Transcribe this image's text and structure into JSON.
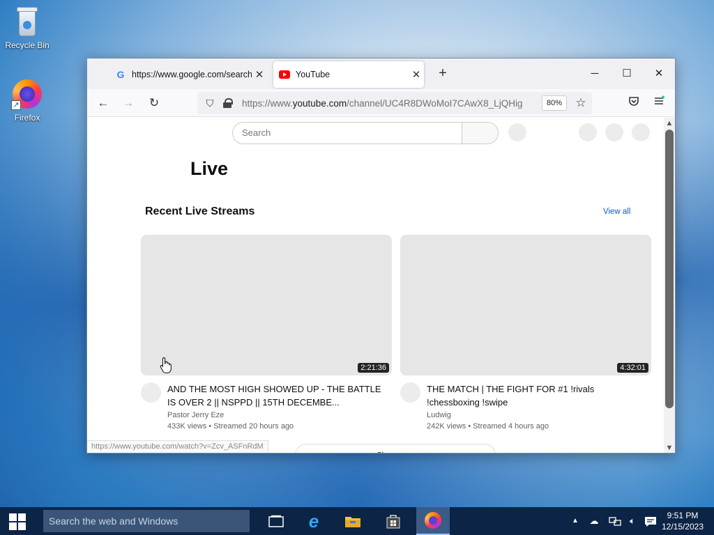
{
  "desktop": {
    "icons": [
      {
        "label": "Recycle Bin",
        "icon": "recycle-bin-icon"
      },
      {
        "label": "Firefox",
        "icon": "firefox-icon"
      }
    ]
  },
  "browser": {
    "tabs": [
      {
        "title": "https://www.google.com/search",
        "favicon": "google-favicon",
        "active": false
      },
      {
        "title": "YouTube",
        "favicon": "youtube-favicon",
        "active": true
      }
    ],
    "new_tab_symbol": "+",
    "window_controls": {
      "minimize": "─",
      "maximize": "☐",
      "close": "✕"
    },
    "nav": {
      "back": "←",
      "forward": "→",
      "reload": "↻"
    },
    "url": {
      "prefix": "https://www.",
      "domain": "youtube.com",
      "path": "/channel/UC4R8DWoMoI7CAwX8_LjQHig"
    },
    "zoom": "80%",
    "status_bar_url": "https://www.youtube.com/watch?v=Zcv_ASFnRdM"
  },
  "youtube": {
    "search_placeholder": "Search",
    "page_title": "Live",
    "section_title": "Recent Live Streams",
    "view_all": "View all",
    "show_more": "Show more",
    "videos": [
      {
        "duration": "2:21:36",
        "title": "AND THE MOST HIGH SHOWED UP - THE BATTLE IS OVER 2 || NSPPD || 15TH DECEMBE...",
        "channel": "Pastor Jerry Eze",
        "meta": "433K views • Streamed 20 hours ago"
      },
      {
        "duration": "4:32:01",
        "title": "THE MATCH | THE FIGHT FOR #1 !rivals !chessboxing !swipe",
        "channel": "Ludwig",
        "meta": "242K views • Streamed 4 hours ago"
      }
    ]
  },
  "taskbar": {
    "search_placeholder": "Search the web and Windows",
    "apps": [
      "task-view",
      "internet-explorer",
      "file-explorer",
      "store",
      "firefox"
    ],
    "time": "9:51 PM",
    "date": "12/15/2023"
  },
  "colors": {
    "taskbar": "#0c2445",
    "link_blue": "#065fd4",
    "youtube_red": "#ff0000"
  }
}
